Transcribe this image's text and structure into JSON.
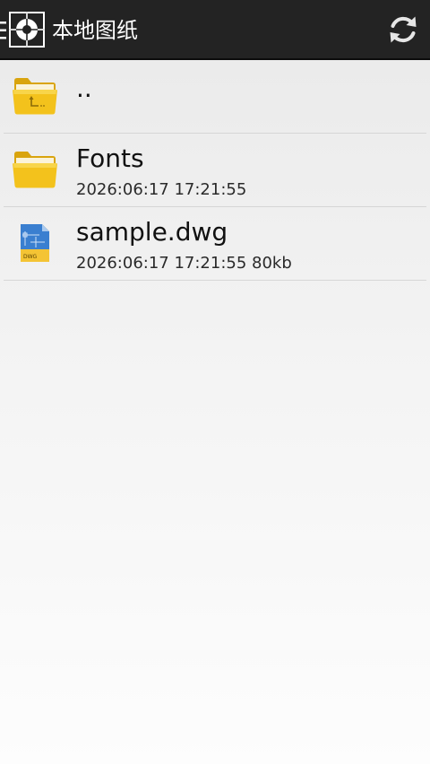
{
  "action_bar": {
    "title": "本地图纸",
    "icons": {
      "menu": "menu-lines-icon",
      "logo": "crosshair-logo-icon",
      "refresh": "refresh-icon"
    }
  },
  "files": [
    {
      "name": "..",
      "meta": "",
      "icon": "folder-up-icon"
    },
    {
      "name": "Fonts",
      "meta": "2026:06:17 17:21:55",
      "icon": "folder-icon"
    },
    {
      "name": "sample.dwg",
      "meta": "2026:06:17 17:21:55  80kb",
      "icon": "dwg-file-icon"
    }
  ],
  "colors": {
    "action_bar": "#232323",
    "folder": "#f3c21c",
    "dwg_blue": "#3a7fd0",
    "dwg_yellow": "#f4c434"
  }
}
